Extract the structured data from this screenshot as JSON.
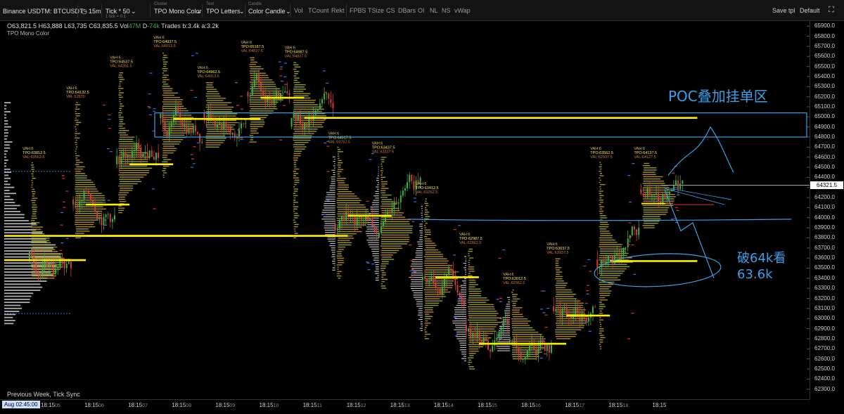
{
  "toolbar": {
    "symbol": "Binance USDTM: BTCUSDT",
    "interval": "15m",
    "tick_label": "Tick * 50",
    "tick_sub": "1 tick = 0.1",
    "cluster_small": "Cluster",
    "cluster": "TPO Mono Color",
    "text_small": "Text",
    "text_mode": "TPO Letters",
    "candle_small": "Candle",
    "candle_mode": "Color Candle",
    "indicators": [
      "Vol",
      "TCount",
      "Rekt",
      "FPBS",
      "TSize",
      "CS",
      "DBars",
      "OI",
      "NL",
      "NS",
      "vWap"
    ],
    "save_tpl": "Save tpl",
    "template": "Default"
  },
  "ohlc": {
    "o_label": "O",
    "o": "63,821.5",
    "h_label": "H",
    "h": "63,888",
    "l_label": "L",
    "l": "63,735",
    "c_label": "C",
    "c": "63,835.5",
    "vol_label": "Vol",
    "vol": "47M",
    "delta_label": "D",
    "delta": "-74k",
    "trades": "Trades b:3.4k a:3.2k"
  },
  "indicator_name": "TPO Mono Color",
  "footer_note": "Previous Week, Tick Sync",
  "annotations": {
    "poc": "POC叠加挂单区",
    "break_line1": "破64k看",
    "break_line2": "63.6k"
  },
  "colors": {
    "poc_line": "#ffee00",
    "annotation": "#3aa0e8",
    "bull": "#3fae3f",
    "bear": "#d23c3c",
    "profile_prev_week": "#cfcfcf"
  },
  "chart_data": {
    "type": "tpo_profile_candlestick",
    "symbol": "BTCUSDT",
    "interval": "15m",
    "ylim": [
      62200,
      65950
    ],
    "y_ticks": [
      62300,
      62400,
      62500,
      62600,
      62700,
      62800,
      62900,
      63000,
      63100,
      63200,
      63300,
      63400,
      63500,
      63600,
      63700,
      63800,
      63900,
      64000,
      64100,
      64200,
      64300,
      64400,
      64500,
      64600,
      64700,
      64800,
      64900,
      65000,
      65100,
      65200,
      65300,
      65400,
      65500,
      65600,
      65700,
      65800,
      65900
    ],
    "x_ticks": [
      {
        "label": "18:15",
        "day": "05"
      },
      {
        "label": "18:15",
        "day": "06"
      },
      {
        "label": "18:15",
        "day": "07"
      },
      {
        "label": "18:15",
        "day": "08"
      },
      {
        "label": "18:15",
        "day": "09"
      },
      {
        "label": "18:15",
        "day": "10"
      },
      {
        "label": "18:15",
        "day": "11"
      },
      {
        "label": "18:15",
        "day": "12"
      },
      {
        "label": "18:15",
        "day": "13"
      },
      {
        "label": "18:15",
        "day": "14"
      },
      {
        "label": "18:15",
        "day": "15"
      },
      {
        "label": "18:15",
        "day": "16"
      },
      {
        "label": "18:15",
        "day": "17"
      },
      {
        "label": "18:15",
        "day": "18"
      },
      {
        "label": "18:15",
        "day": ""
      }
    ],
    "time_cursor": "Aug 02:45:00",
    "last_price": 64321.5,
    "last_price_label": "64321.5",
    "sessions": [
      {
        "poc": 63580,
        "vah": "6",
        "tpo": "63812.5",
        "val": "63562.5",
        "low": 63400,
        "high": 64550
      },
      {
        "poc": 64130,
        "vah": "6",
        "tpo": "64132.5",
        "val": "63870",
        "low": 63800,
        "high": 65150
      },
      {
        "poc": 64530,
        "vah": "6",
        "tpo": "64537.5",
        "val": "64281.5",
        "low": 64050,
        "high": 65450
      },
      {
        "poc": 64960,
        "vah": "6",
        "tpo": "64937.5",
        "val": "64913.5",
        "low": 64400,
        "high": 65650
      },
      {
        "poc": 64980,
        "vah": "6",
        "tpo": "64962.5",
        "val": "64913.5",
        "low": 64700,
        "high": 65350
      },
      {
        "poc": 65190,
        "vah": "6",
        "tpo": "65187.5",
        "val": "64827.5",
        "low": 64750,
        "high": 65600
      },
      {
        "poc": 64990,
        "vah": "6",
        "tpo": "64987.5",
        "val": "64837.5",
        "low": 63800,
        "high": 65550
      },
      {
        "poc": 64020,
        "vah": "6",
        "tpo": "64017.5",
        "val": "63762.5",
        "low": 63400,
        "high": 64700
      },
      {
        "poc": 63880,
        "vah": "6",
        "tpo": "63437.5",
        "val": "63337.5",
        "low": 63300,
        "high": 64600
      },
      {
        "poc": 63410,
        "vah": "6",
        "tpo": "63412.5",
        "val": "63262.5",
        "low": 62800,
        "high": 64200
      },
      {
        "poc": 62990,
        "vah": "6",
        "tpo": "62987.5",
        "val": "62862.5",
        "low": 62500,
        "high": 63700
      },
      {
        "poc": 62750,
        "vah": "6",
        "tpo": "63012.5",
        "val": "62962.5",
        "low": 62600,
        "high": 63300
      },
      {
        "poc": 63030,
        "vah": "6",
        "tpo": "63037.5",
        "val": "62937.5",
        "low": 62800,
        "high": 63600
      },
      {
        "poc": 63570,
        "vah": "6",
        "tpo": "63562.5",
        "val": "62937.5",
        "low": 62700,
        "high": 64550
      },
      {
        "poc": 64190,
        "vah": "6",
        "tpo": "64137.5",
        "val": "64127.5",
        "low": 63900,
        "high": 64550
      }
    ],
    "poc_levels": [
      {
        "price": 63580,
        "from_session": 0,
        "to_session": 0
      },
      {
        "price": 63820,
        "from_session": 1,
        "to_session": 6
      },
      {
        "price": 64130,
        "from_session": 1,
        "to_session": 1
      },
      {
        "price": 64530,
        "from_session": 2,
        "to_session": 2
      },
      {
        "price": 64980,
        "from_session": 3,
        "to_session": 4
      },
      {
        "price": 65190,
        "from_session": 5,
        "to_session": 5
      },
      {
        "price": 64990,
        "from_session": 6,
        "to_session": 14
      },
      {
        "price": 64020,
        "from_session": 7,
        "to_session": 7
      },
      {
        "price": 63410,
        "from_session": 9,
        "to_session": 9
      },
      {
        "price": 62750,
        "from_session": 10,
        "to_session": 11
      },
      {
        "price": 63030,
        "from_session": 12,
        "to_session": 12
      },
      {
        "price": 63570,
        "from_session": 13,
        "to_session": 14
      }
    ]
  }
}
